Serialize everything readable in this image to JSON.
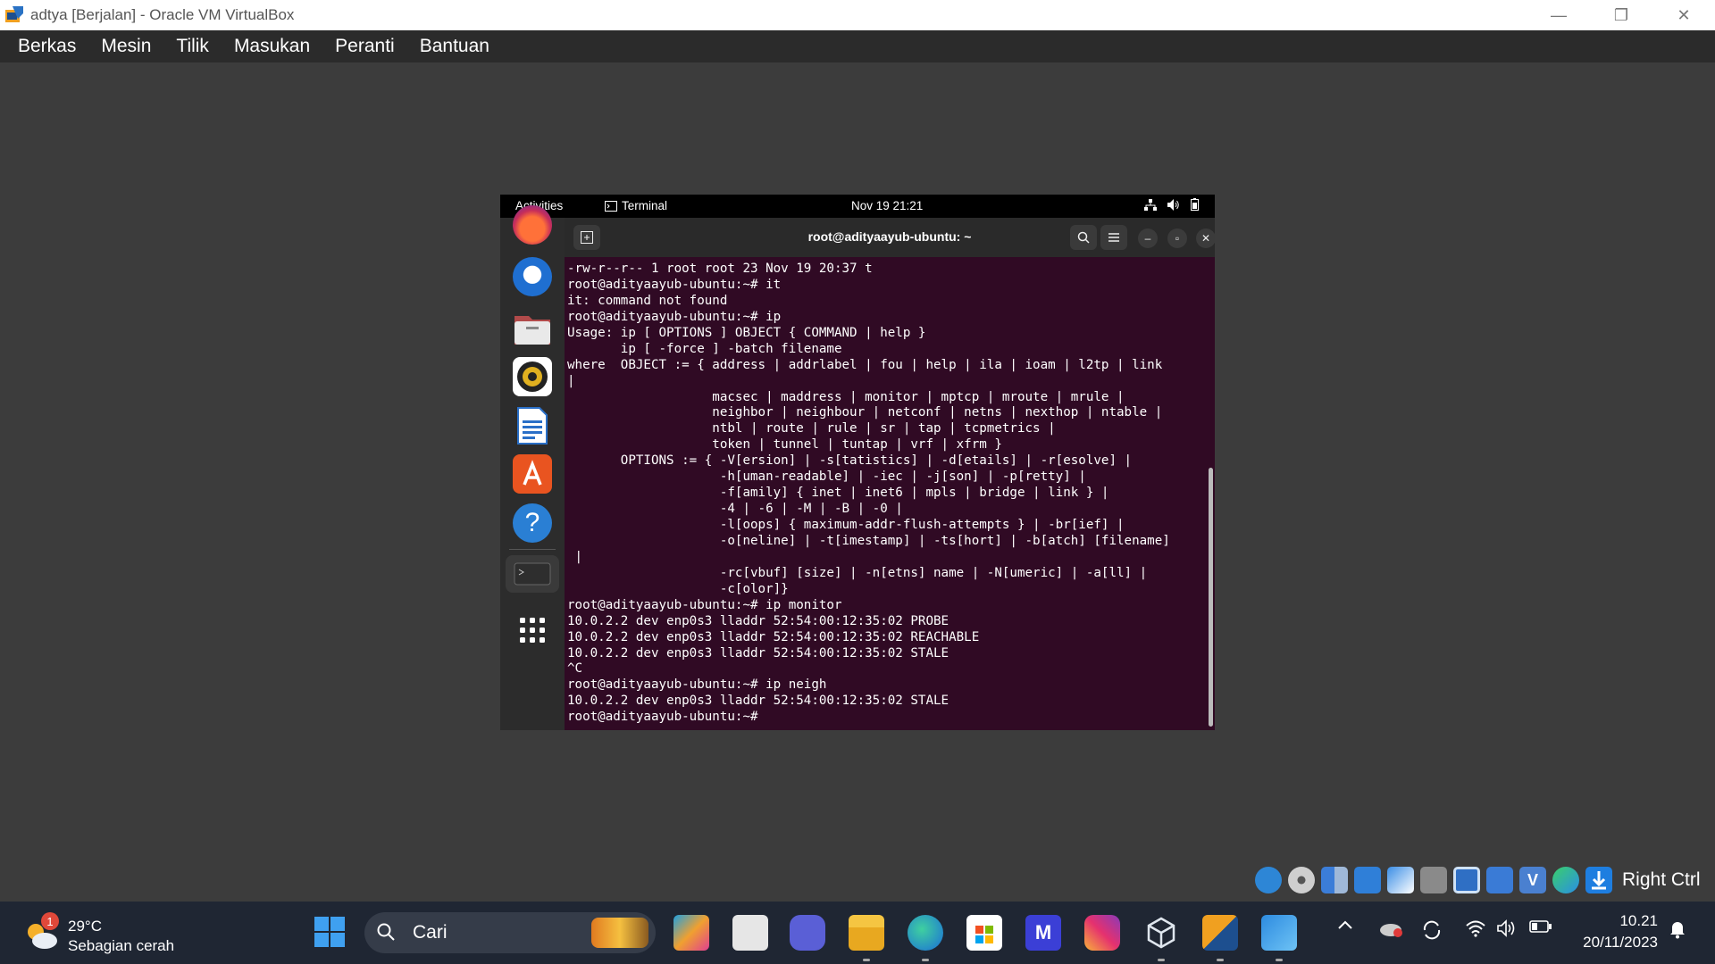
{
  "window": {
    "title": "adtya [Berjalan] - Oracle VM VirtualBox",
    "controls": [
      "minimize",
      "restore",
      "close"
    ]
  },
  "menubar": {
    "items": [
      "Berkas",
      "Mesin",
      "Tilik",
      "Masukan",
      "Peranti",
      "Bantuan"
    ]
  },
  "guest": {
    "topbar": {
      "activities": "Activities",
      "app_name": "Terminal",
      "datetime": "Nov 19  21:21"
    },
    "dock_icons": [
      "firefox-icon",
      "thunderbird-icon",
      "files-icon",
      "rhythmbox-icon",
      "writer-icon",
      "app-center-icon",
      "help-icon",
      "terminal-icon",
      "show-apps-icon"
    ],
    "terminal": {
      "title": "root@adityaayub-ubuntu: ~",
      "lines": [
        "-rw-r--r-- 1 root root 23 Nov 19 20:37 t",
        "root@adityaayub-ubuntu:~# it",
        "it: command not found",
        "root@adityaayub-ubuntu:~# ip",
        "Usage: ip [ OPTIONS ] OBJECT { COMMAND | help }",
        "       ip [ -force ] -batch filename",
        "where  OBJECT := { address | addrlabel | fou | help | ila | ioam | l2tp | link",
        "|",
        "                   macsec | maddress | monitor | mptcp | mroute | mrule |",
        "                   neighbor | neighbour | netconf | netns | nexthop | ntable |",
        "                   ntbl | route | rule | sr | tap | tcpmetrics |",
        "                   token | tunnel | tuntap | vrf | xfrm }",
        "       OPTIONS := { -V[ersion] | -s[tatistics] | -d[etails] | -r[esolve] |",
        "                    -h[uman-readable] | -iec | -j[son] | -p[retty] |",
        "                    -f[amily] { inet | inet6 | mpls | bridge | link } |",
        "                    -4 | -6 | -M | -B | -0 |",
        "                    -l[oops] { maximum-addr-flush-attempts } | -br[ief] |",
        "                    -o[neline] | -t[imestamp] | -ts[hort] | -b[atch] [filename]",
        " |",
        "                    -rc[vbuf] [size] | -n[etns] name | -N[umeric] | -a[ll] |",
        "                    -c[olor]}",
        "root@adityaayub-ubuntu:~# ip monitor",
        "10.0.2.2 dev enp0s3 lladdr 52:54:00:12:35:02 PROBE",
        "10.0.2.2 dev enp0s3 lladdr 52:54:00:12:35:02 REACHABLE",
        "10.0.2.2 dev enp0s3 lladdr 52:54:00:12:35:02 STALE",
        "^C",
        "root@adityaayub-ubuntu:~# ip neigh",
        "10.0.2.2 dev enp0s3 lladdr 52:54:00:12:35:02 STALE",
        "root@adityaayub-ubuntu:~# "
      ]
    }
  },
  "vm_status": {
    "host_key": "Right Ctrl",
    "icons": [
      "hard-disk-icon",
      "optical-disk-icon",
      "audio-icon",
      "network-icon",
      "usb-icon",
      "shared-folders-icon",
      "display-icon",
      "recording-icon",
      "vt-x-icon",
      "mouse-integration-icon",
      "download-icon"
    ]
  },
  "taskbar": {
    "weather": {
      "temp": "29°C",
      "desc": "Sebagian cerah",
      "badge": "1"
    },
    "search_placeholder": "Cari",
    "time": "10.21",
    "date": "20/11/2023"
  },
  "colors": {
    "terminal_bg": "#300a24",
    "taskbar_bg": "#1f2633",
    "menubar_bg": "#2b2b2b",
    "vm_area_bg": "#3c3c3c"
  }
}
